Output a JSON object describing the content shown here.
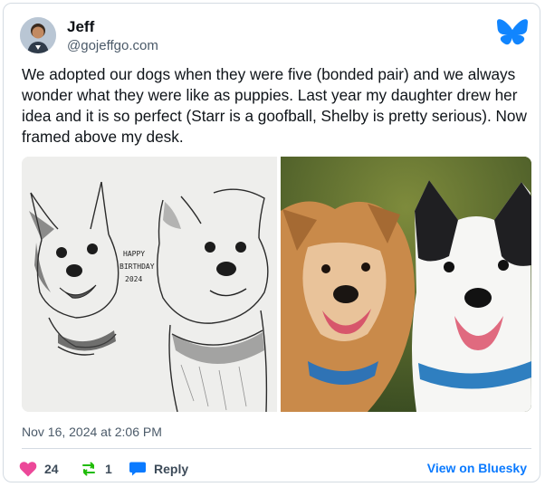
{
  "author": {
    "name": "Jeff",
    "handle": "@gojeffgo.com",
    "avatar_icon": "user-avatar"
  },
  "platform": {
    "logo_icon": "bluesky-butterfly-icon",
    "brand_color": "#0a7aff"
  },
  "post": {
    "text": "We adopted our dogs when they were five (bonded pair) and we always wonder what they were like as puppies. Last year my daughter drew her idea and it is so perfect (Starr is a goofball, Shelby is pretty serious). Now framed above my desk.",
    "images": [
      {
        "kind": "pencil drawing of two dogs",
        "drawing_text": [
          "HAPPY",
          "BIRTHDAY",
          "2024"
        ]
      },
      {
        "kind": "photo of two dogs"
      }
    ],
    "timestamp": "Nov 16, 2024 at 2:06 PM"
  },
  "actions": {
    "likes": {
      "count": "24",
      "icon": "heart-icon",
      "color": "#ec4899"
    },
    "reposts": {
      "count": "1",
      "icon": "repost-icon",
      "color": "#20bc07"
    },
    "reply": {
      "label": "Reply",
      "icon": "reply-bubble-icon",
      "color": "#0a7aff"
    },
    "view_link": "View on Bluesky"
  }
}
